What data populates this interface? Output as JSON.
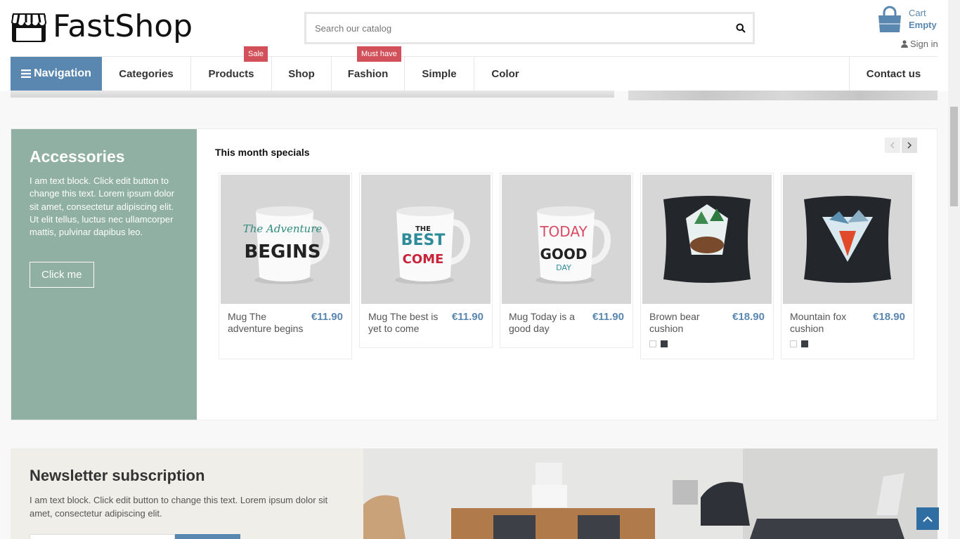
{
  "header": {
    "logo_text": "FastShop",
    "search_placeholder": "Search our catalog",
    "cart_label": "Cart",
    "cart_status": "Empty",
    "signin_label": "Sign in"
  },
  "nav": {
    "main_label": "Navigation",
    "items": [
      {
        "label": "Categories"
      },
      {
        "label": "Products",
        "badge": "Sale"
      },
      {
        "label": "Shop"
      },
      {
        "label": "Fashion",
        "badge": "Must have"
      },
      {
        "label": "Simple"
      },
      {
        "label": "Color"
      }
    ],
    "contact_label": "Contact us"
  },
  "accessories": {
    "title": "Accessories",
    "text": "I am text block. Click edit button to change this text. Lorem ipsum dolor sit amet, consectetur adipiscing elit. Ut elit tellus, luctus nec ullamcorper mattis, pulvinar dapibus leo.",
    "button_label": "Click me"
  },
  "specials": {
    "title": "This month specials",
    "products": [
      {
        "name": "Mug The adventure begins",
        "price": "€11.90",
        "image": "mug-adventure"
      },
      {
        "name": "Mug The best is yet to come",
        "price": "€11.90",
        "image": "mug-best"
      },
      {
        "name": "Mug Today is a good day",
        "price": "€11.90",
        "image": "mug-today"
      },
      {
        "name": "Brown bear cushion",
        "price": "€18.90",
        "image": "cushion-bear",
        "swatches": [
          "#ffffff",
          "#3a3d42"
        ]
      },
      {
        "name": "Mountain fox cushion",
        "price": "€18.90",
        "image": "cushion-fox",
        "swatches": [
          "#ffffff",
          "#3a3d42"
        ]
      }
    ]
  },
  "newsletter": {
    "title": "Newsletter subscription",
    "text": "I am text block. Click edit button to change this text. Lorem ipsum dolor sit amet, consectetur adipiscing elit."
  },
  "colors": {
    "accent": "#5a87b0",
    "badge": "#d1505a",
    "accessories_bg": "#8fb0a2"
  }
}
